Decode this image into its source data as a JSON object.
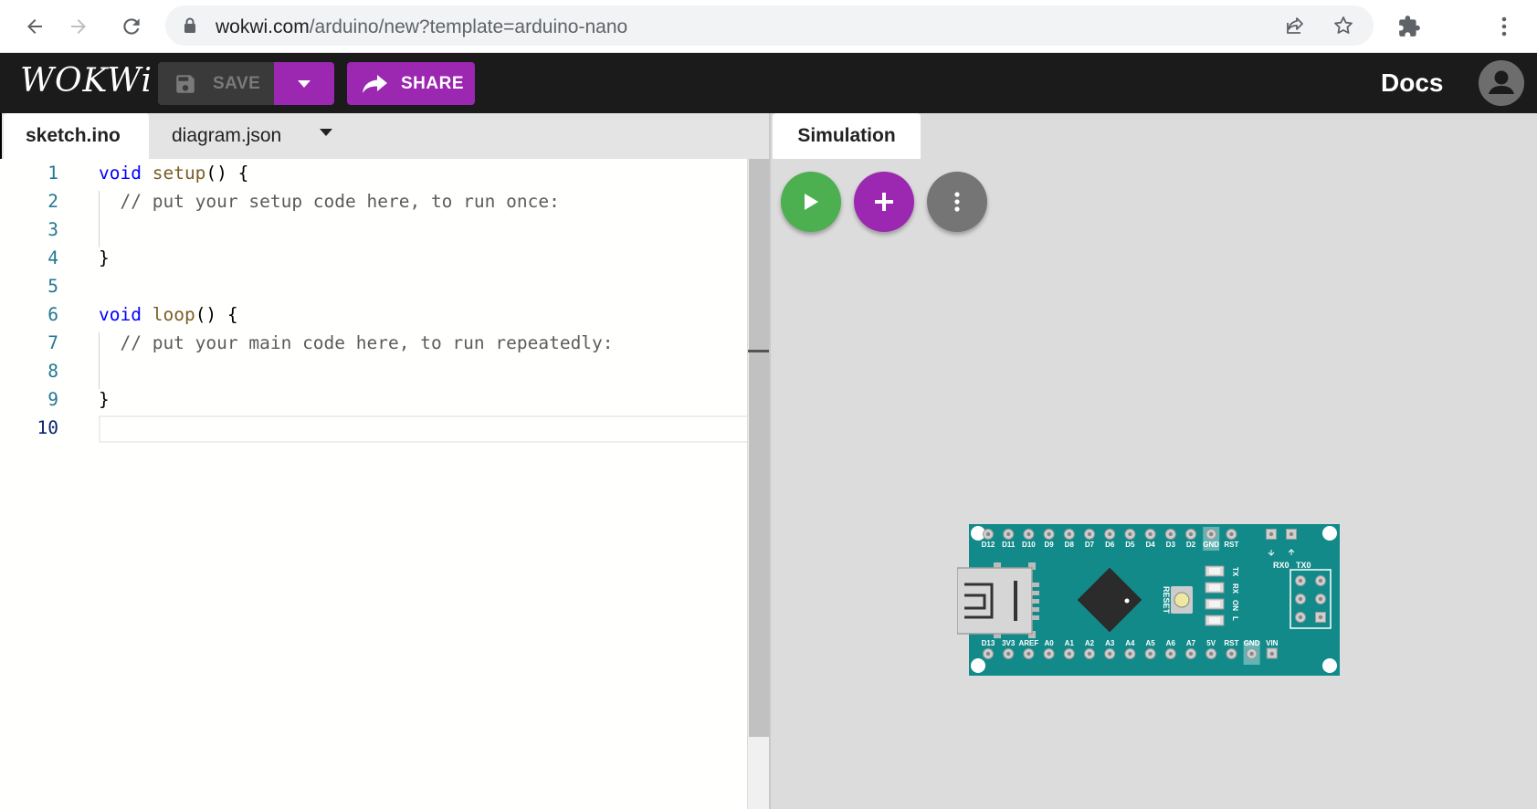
{
  "browser": {
    "url_host": "wokwi.com",
    "url_path": "/arduino/new?template=arduino-nano"
  },
  "appbar": {
    "logo": "WOKWi",
    "save_label": "SAVE",
    "share_label": "SHARE",
    "docs_label": "Docs"
  },
  "editor": {
    "tabs": [
      {
        "label": "sketch.ino",
        "active": true
      },
      {
        "label": "diagram.json",
        "active": false
      }
    ],
    "line_numbers": [
      "1",
      "2",
      "3",
      "4",
      "5",
      "6",
      "7",
      "8",
      "9",
      "10"
    ],
    "lines": [
      {
        "kw": "void",
        "fn": "setup",
        "rest": "() {"
      },
      {
        "comment": "// put your setup code here, to run once:"
      },
      {
        "text": ""
      },
      {
        "text": "}"
      },
      {
        "text": ""
      },
      {
        "kw": "void",
        "fn": "loop",
        "rest": "() {"
      },
      {
        "comment": "// put your main code here, to run repeatedly:"
      },
      {
        "text": ""
      },
      {
        "text": "}"
      },
      {
        "text": ""
      }
    ]
  },
  "simulation": {
    "tab_label": "Simulation",
    "buttons": [
      "start-simulation",
      "add-part",
      "more-options"
    ],
    "colors": {
      "play": "#4caf50",
      "add": "#9c27b0",
      "more": "#757575"
    },
    "board": {
      "top_pins": [
        "D12",
        "D11",
        "D10",
        "D9",
        "D8",
        "D7",
        "D6",
        "D5",
        "D4",
        "D3",
        "D2",
        "GND",
        "RST"
      ],
      "bottom_pins": [
        "D13",
        "3V3",
        "AREF",
        "A0",
        "A1",
        "A2",
        "A3",
        "A4",
        "A5",
        "A6",
        "A7",
        "5V",
        "RST",
        "GND",
        "VIN"
      ],
      "rx_label": "RX0",
      "tx_label": "TX0",
      "reset_label": "RESET",
      "led_labels": [
        "TX",
        "RX",
        "ON",
        "L"
      ]
    }
  },
  "colors": {
    "accent": "#9c27b0",
    "board": "#138a8a"
  }
}
